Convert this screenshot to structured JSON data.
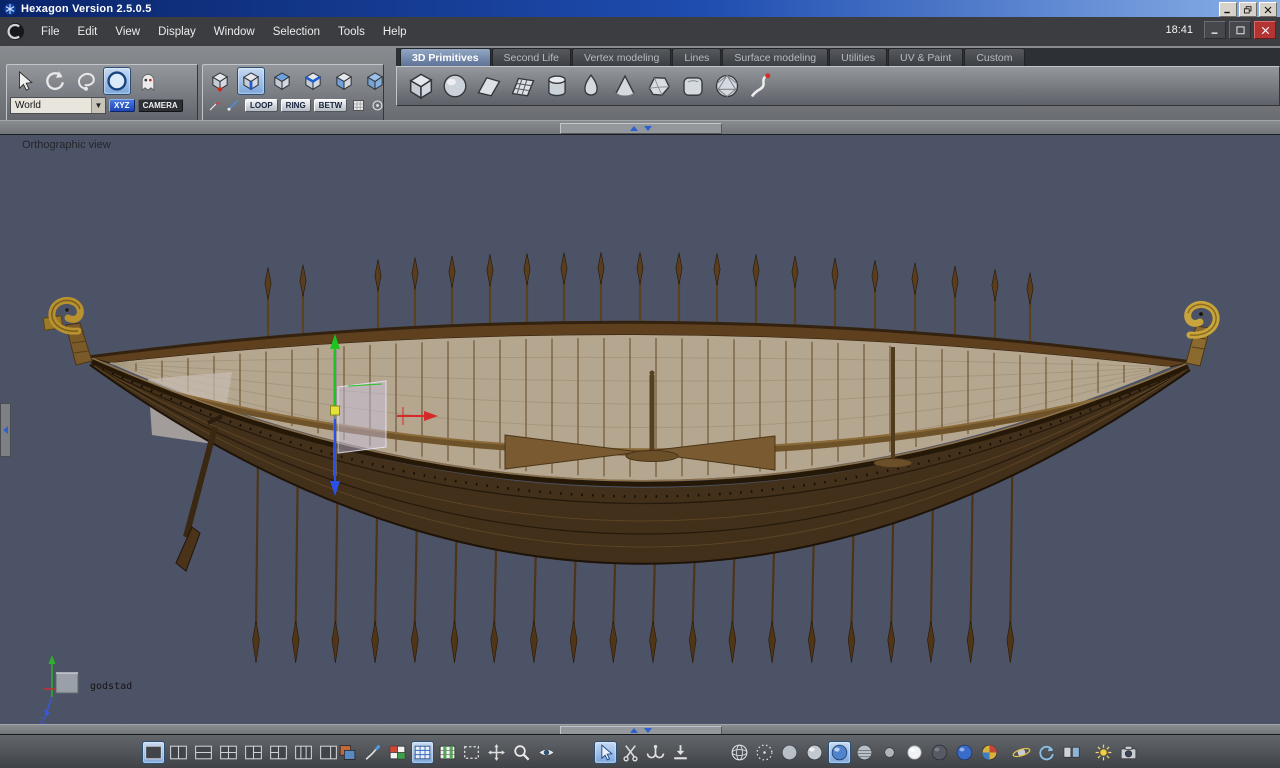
{
  "titlebar": {
    "title": "Hexagon Version 2.5.0.5"
  },
  "menubar": {
    "items": [
      "File",
      "Edit",
      "View",
      "Display",
      "Window",
      "Selection",
      "Tools",
      "Help"
    ],
    "time": "18:41"
  },
  "tabs": [
    {
      "label": "3D Primitives",
      "active": true
    },
    {
      "label": "Second Life"
    },
    {
      "label": "Vertex modeling"
    },
    {
      "label": "Lines"
    },
    {
      "label": "Surface modeling"
    },
    {
      "label": "Utilities"
    },
    {
      "label": "UV & Paint"
    },
    {
      "label": "Custom"
    }
  ],
  "left_toolbar": {
    "world_label": "World",
    "xyz_label": "XYZ",
    "camera_label": "CAMERA",
    "select_tools": [
      {
        "name": "select-arrow-icon"
      },
      {
        "name": "rotate-tool-icon"
      },
      {
        "name": "lasso-tool-icon"
      },
      {
        "name": "circle-select-icon",
        "active": true
      },
      {
        "name": "ghost-tool-icon"
      }
    ]
  },
  "selection_toolbar": {
    "cube_tools": [
      {
        "name": "cube-points-icon"
      },
      {
        "name": "cube-edges-icon",
        "active": true
      },
      {
        "name": "cube-faces-icon"
      },
      {
        "name": "cube-edge-loop-icon"
      },
      {
        "name": "cube-face-select-icon"
      },
      {
        "name": "cube-object-icon"
      }
    ],
    "mini_left": [
      {
        "name": "mini-pencil-icon"
      },
      {
        "name": "mini-mark-icon"
      }
    ],
    "loop_label": "LOOP",
    "ring_label": "RING",
    "betw_label": "BETW",
    "mini_right": [
      {
        "name": "mini-grid-icon"
      },
      {
        "name": "mini-target-icon"
      }
    ]
  },
  "primitives_toolbar": {
    "items": [
      {
        "name": "cube-primitive-icon"
      },
      {
        "name": "sphere-primitive-icon"
      },
      {
        "name": "facet-primitive-icon"
      },
      {
        "name": "grid-primitive-icon"
      },
      {
        "name": "cylinder-primitive-icon"
      },
      {
        "name": "oloid-primitive-icon"
      },
      {
        "name": "cone-primitive-icon"
      },
      {
        "name": "polygon-primitive-icon"
      },
      {
        "name": "rounded-cube-primitive-icon"
      },
      {
        "name": "geodesic-primitive-icon"
      },
      {
        "name": "spline-primitive-icon"
      }
    ]
  },
  "viewport": {
    "view_label": "Orthographic view",
    "object_name": "godstad",
    "axis_z_label": "Z"
  },
  "bottom_toolbar": {
    "groups": [
      [
        {
          "name": "layout-single-icon",
          "active": true
        },
        {
          "name": "layout-split-h-icon"
        },
        {
          "name": "layout-split-v-icon"
        },
        {
          "name": "layout-quad-icon"
        },
        {
          "name": "layout-1-2-icon"
        },
        {
          "name": "layout-2-1-icon"
        },
        {
          "name": "layout-3col-icon"
        },
        {
          "name": "layout-2col-icon"
        }
      ],
      [
        {
          "name": "palette-icon"
        },
        {
          "name": "brush-icon"
        },
        {
          "name": "rgb-grid-icon"
        },
        {
          "name": "uv-grid-icon",
          "active": true
        },
        {
          "name": "green-grid-icon"
        }
      ],
      [
        {
          "name": "marquee-icon"
        },
        {
          "name": "pan-icon"
        },
        {
          "name": "zoom-icon"
        },
        {
          "name": "eye-icon"
        }
      ],
      [
        {
          "name": "pointer-icon",
          "active": true
        },
        {
          "name": "snip-icon"
        },
        {
          "name": "hook-icon"
        },
        {
          "name": "drop-icon"
        }
      ],
      [
        {
          "name": "wireframe-sphere-icon"
        },
        {
          "name": "dotted-sphere-icon"
        },
        {
          "name": "flat-sphere-icon"
        },
        {
          "name": "smooth-sphere-icon"
        },
        {
          "name": "shaded-sphere-icon",
          "active": true
        },
        {
          "name": "textured-sphere-icon"
        },
        {
          "name": "small-sphere-icon"
        },
        {
          "name": "white-sphere-icon"
        }
      ],
      [
        {
          "name": "dark-sphere-icon"
        },
        {
          "name": "blue-sphere-icon"
        },
        {
          "name": "multi-sphere-icon"
        }
      ],
      [
        {
          "name": "orbit-icon"
        },
        {
          "name": "refresh-icon"
        },
        {
          "name": "dual-view-icon"
        }
      ],
      [
        {
          "name": "sun-icon"
        },
        {
          "name": "render-camera-icon"
        }
      ]
    ]
  },
  "colors": {
    "accent_blue": "#2d5fb8",
    "viewport_bg": "#4d5366",
    "title_gradient_start": "#0a246a",
    "title_gradient_end": "#8ab0e8"
  }
}
